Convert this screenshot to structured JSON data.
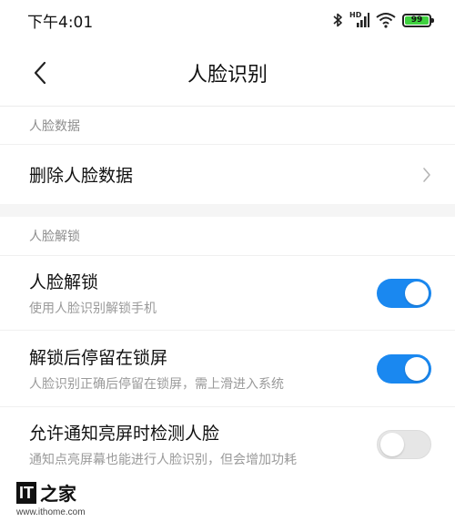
{
  "status_bar": {
    "time": "下午4:01",
    "network_label": "HD",
    "battery_level": "99",
    "icons": [
      "bluetooth-icon",
      "signal-icon",
      "wifi-icon",
      "battery-icon"
    ]
  },
  "header": {
    "title": "人脸识别",
    "back_icon": "chevron-left-icon"
  },
  "sections": [
    {
      "header": "人脸数据",
      "rows": [
        {
          "title": "删除人脸数据",
          "trailing": "chevron-right-icon"
        }
      ]
    },
    {
      "header": "人脸解锁",
      "rows": [
        {
          "title": "人脸解锁",
          "subtitle": "使用人脸识别解锁手机",
          "toggle": true
        },
        {
          "title": "解锁后停留在锁屏",
          "subtitle": "人脸识别正确后停留在锁屏，需上滑进入系统",
          "toggle": true
        },
        {
          "title": "允许通知亮屏时检测人脸",
          "subtitle": "通知点亮屏幕也能进行人脸识别，但会增加功耗",
          "toggle": false
        }
      ]
    }
  ],
  "watermark": {
    "logo_text": "IT",
    "logo_glyph": "之家",
    "url": "www.ithome.com"
  },
  "colors": {
    "accent": "#1a88f0",
    "toggle_off": "#e6e6e6",
    "section_header_text": "#8e8e8e",
    "subtitle_text": "#9a9a9a",
    "battery_fill": "#3fd13f"
  }
}
